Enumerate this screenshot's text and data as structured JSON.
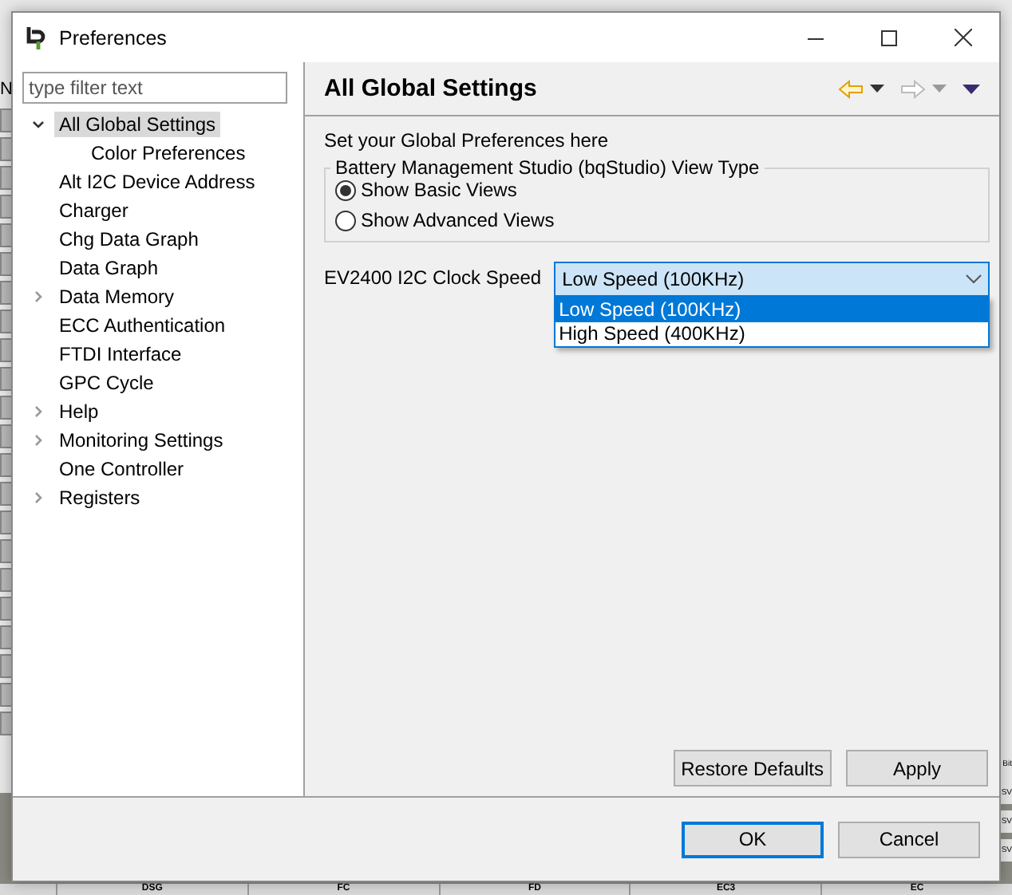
{
  "background_app": {
    "side_label": "N",
    "right_labels": [
      "Bit",
      "SV",
      "SV",
      "SV"
    ],
    "column_headers": [
      "DSG",
      "FC",
      "FD",
      "EC3",
      "EC"
    ]
  },
  "window": {
    "title": "Preferences"
  },
  "filter": {
    "placeholder": "type filter text"
  },
  "tree": [
    {
      "label": "All Global Settings",
      "selected": true,
      "expanded": true,
      "children": [
        {
          "label": "Color Preferences",
          "selected": false
        }
      ]
    },
    {
      "label": "Alt I2C Device Address",
      "selected": false
    },
    {
      "label": "Charger",
      "selected": false
    },
    {
      "label": "Chg Data Graph",
      "selected": false
    },
    {
      "label": "Data Graph",
      "selected": false
    },
    {
      "label": "Data Memory",
      "selected": false,
      "expanded": false
    },
    {
      "label": "ECC Authentication",
      "selected": false
    },
    {
      "label": "FTDI Interface",
      "selected": false
    },
    {
      "label": "GPC Cycle",
      "selected": false
    },
    {
      "label": "Help",
      "selected": false,
      "expanded": false
    },
    {
      "label": "Monitoring Settings",
      "selected": false,
      "expanded": false
    },
    {
      "label": "One Controller",
      "selected": false
    },
    {
      "label": "Registers",
      "selected": false,
      "expanded": false
    }
  ],
  "page": {
    "title": "All Global Settings",
    "description": "Set your Global Preferences here",
    "view_type": {
      "legend": "Battery Management Studio (bqStudio) View Type",
      "options": [
        {
          "label": "Show Basic Views",
          "selected": true
        },
        {
          "label": "Show Advanced Views",
          "selected": false
        }
      ]
    },
    "clock_speed": {
      "label": "EV2400 I2C Clock Speed",
      "value": "Low Speed (100KHz)",
      "expanded": true,
      "options": [
        {
          "label": "Low Speed (100KHz)",
          "selected": true
        },
        {
          "label": "High Speed (400KHz)",
          "selected": false
        }
      ]
    },
    "buttons": [
      "Restore Defaults",
      "Apply"
    ]
  },
  "dialog_buttons": [
    {
      "label": "OK",
      "default": true
    },
    {
      "label": "Cancel",
      "default": false
    }
  ]
}
